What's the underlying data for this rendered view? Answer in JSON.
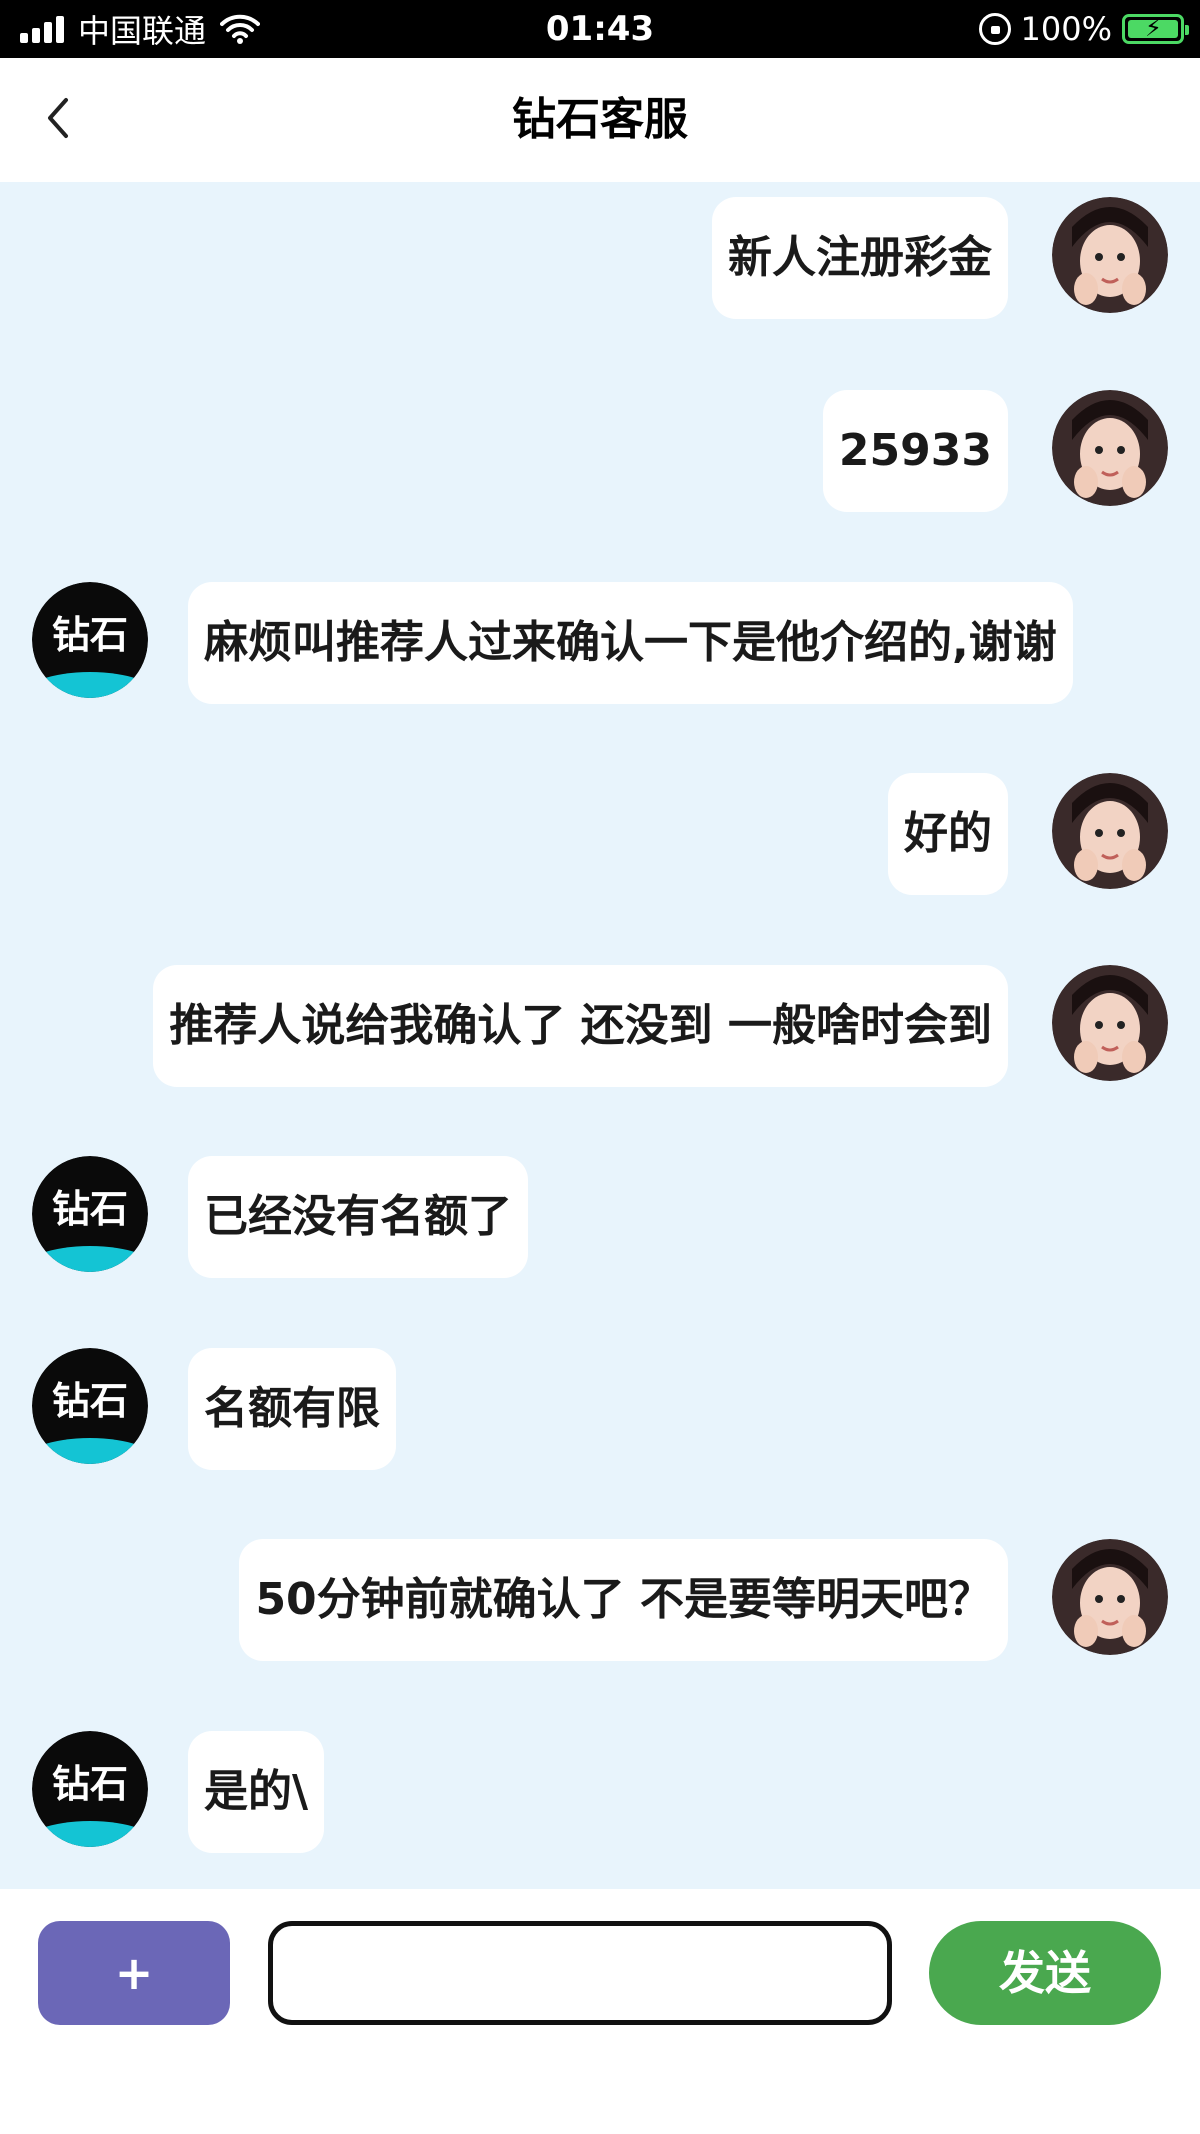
{
  "status_bar": {
    "carrier": "中国联通",
    "time": "01:43",
    "battery": "100%"
  },
  "header": {
    "title": "钻石客服"
  },
  "service_avatar_text": "钻石",
  "messages": [
    {
      "side": "right",
      "text": "新人注册彩金"
    },
    {
      "side": "right",
      "text": "25933"
    },
    {
      "side": "left",
      "text": "麻烦叫推荐人过来确认一下是他介绍的,谢谢"
    },
    {
      "side": "right",
      "text": "好的"
    },
    {
      "side": "right",
      "text": "推荐人说给我确认了 还没到 一般啥时会到"
    },
    {
      "side": "left",
      "text": "已经没有名额了"
    },
    {
      "side": "left",
      "text": "名额有限"
    },
    {
      "side": "right",
      "text": "50分钟前就确认了 不是要等明天吧？"
    },
    {
      "side": "left",
      "text": "是的\\"
    }
  ],
  "composer": {
    "plus_label": "+",
    "input_value": "",
    "send_label": "发送"
  },
  "colors": {
    "chat_background": "#e8f4fc",
    "plus_button": "#6b67b7",
    "send_button": "#4aa84f",
    "service_avatar_accent": "#14c4d4"
  }
}
